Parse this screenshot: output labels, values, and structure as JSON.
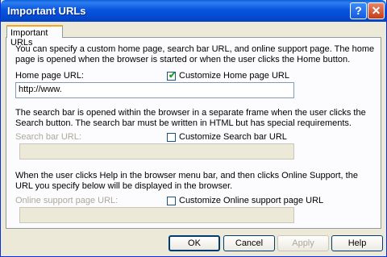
{
  "window": {
    "title": "Important URLs",
    "help_icon": "?",
    "close_icon": "✕"
  },
  "tab": {
    "label": "Important URLs"
  },
  "intro": "You can specify a custom home page, search bar URL, and online support page. The home page is opened when the browser is started or when the user clicks the Home button.",
  "home": {
    "label": "Home page URL:",
    "checkbox_label": "Customize Home page URL",
    "checked": true,
    "value": "http://www."
  },
  "search_desc": "The search bar is opened within the browser in a separate frame when the user clicks the Search button. The search bar must be written in HTML but has special requirements.",
  "search": {
    "label": "Search bar URL:",
    "checkbox_label": "Customize Search bar URL",
    "checked": false,
    "value": ""
  },
  "support_desc": "When the user clicks Help in the browser menu bar, and then clicks Online Support, the URL you specify below will be displayed in the browser.",
  "support": {
    "label": "Online support page URL:",
    "checkbox_label": "Customize Online support page URL",
    "checked": false,
    "value": ""
  },
  "buttons": {
    "ok": "OK",
    "cancel": "Cancel",
    "apply": "Apply",
    "help": "Help"
  },
  "check_glyph": "✔"
}
